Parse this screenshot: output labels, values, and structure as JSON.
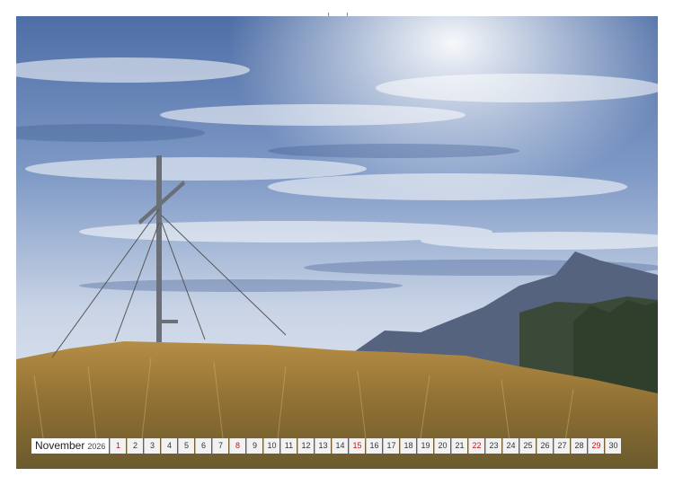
{
  "calendar": {
    "month": "November",
    "year": "2026",
    "days": [
      {
        "d": "1",
        "sun": true
      },
      {
        "d": "2"
      },
      {
        "d": "3"
      },
      {
        "d": "4"
      },
      {
        "d": "5"
      },
      {
        "d": "6"
      },
      {
        "d": "7"
      },
      {
        "d": "8",
        "sun": true
      },
      {
        "d": "9"
      },
      {
        "d": "10"
      },
      {
        "d": "11"
      },
      {
        "d": "12"
      },
      {
        "d": "13"
      },
      {
        "d": "14"
      },
      {
        "d": "15",
        "sun": true
      },
      {
        "d": "16"
      },
      {
        "d": "17"
      },
      {
        "d": "18"
      },
      {
        "d": "19"
      },
      {
        "d": "20"
      },
      {
        "d": "21"
      },
      {
        "d": "22",
        "sun": true
      },
      {
        "d": "23"
      },
      {
        "d": "24"
      },
      {
        "d": "25"
      },
      {
        "d": "26"
      },
      {
        "d": "27"
      },
      {
        "d": "28"
      },
      {
        "d": "29",
        "sun": true
      },
      {
        "d": "30"
      }
    ],
    "sunday_color": "#d0101a"
  },
  "photo": {
    "sky_color": "#5b7bb0",
    "grass_color": "#9a7a3a"
  }
}
